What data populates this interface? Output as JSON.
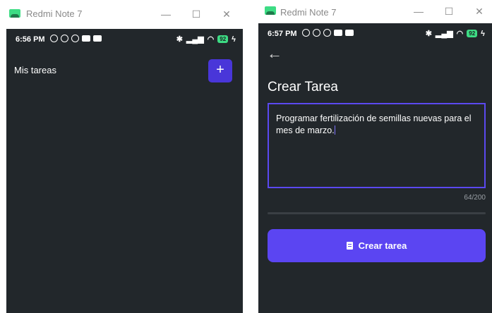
{
  "left_window": {
    "title": "Redmi Note 7",
    "controls": {
      "minimize": "—",
      "maximize": "☐",
      "close": "✕"
    },
    "status": {
      "time": "6:56 PM",
      "battery": "92"
    },
    "screen": {
      "heading": "Mis tareas",
      "add_label": "+"
    }
  },
  "right_window": {
    "title": "Redmi Note 7",
    "controls": {
      "minimize": "—",
      "maximize": "☐",
      "close": "✕"
    },
    "status": {
      "time": "6:57 PM",
      "battery": "92"
    },
    "screen": {
      "back_label": "←",
      "heading": "Crear Tarea",
      "task_text": "Programar fertilización de semillas nuevas para el mes de marzo.",
      "char_count": "64/200",
      "create_button_label": "Crear tarea"
    }
  },
  "colors": {
    "phone_background": "#22272b",
    "accent": "#5b45f2",
    "battery": "#3ddc84"
  }
}
